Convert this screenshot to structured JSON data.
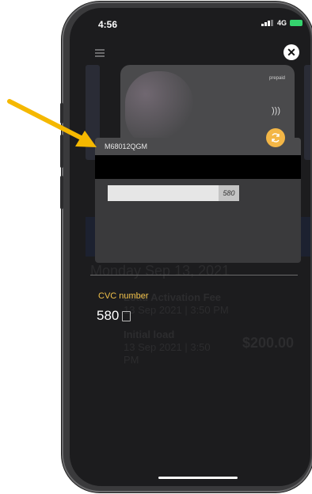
{
  "status_bar": {
    "time": "4:56",
    "network": "4G"
  },
  "card": {
    "prepaid_label": "prepaid"
  },
  "popup": {
    "card_id": "M68012QGM",
    "field_value": "580"
  },
  "transactions": {
    "date_heading": "Monday Sep 13, 2021",
    "items": [
      {
        "title": "Load Activation Fee",
        "date": "13 Sep 2021 | 3:50 PM"
      },
      {
        "title": "Initial load",
        "date": "13 Sep 2021 | 3:50 PM",
        "amount": "$200.00"
      }
    ]
  },
  "cvc": {
    "label": "CVC number",
    "value": "580"
  },
  "colors": {
    "accent": "#f3b646",
    "arrow": "#f5b800"
  }
}
